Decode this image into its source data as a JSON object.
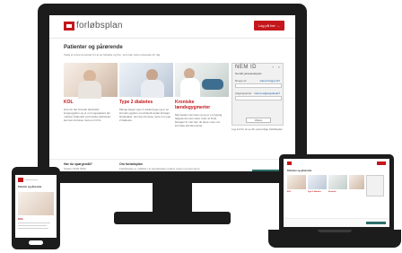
{
  "site": {
    "logo_text": "forløbsplan",
    "login_label": "Log på her →",
    "page_title": "Patienter og pårørende",
    "intro": "Vælg et emne herunder for at se forløbet og finn, som kan være relevante for dig."
  },
  "cards": [
    {
      "title": "KOL",
      "body": "Hvis du har Kronisk obstruktiv lungesygdom og er en lungepatient der mærker åndenød ved fysiske aktiviteter. Her kan du læse mere om KOL."
    },
    {
      "title": "Type 2 diabetes",
      "body": "Mange lægen type 2 sukkersyge og er en kronisk sygdom med blandt andet forhøjet blodsukker. Her kan du læse mere om type 2 diabetes."
    },
    {
      "title": "Kroniske lændegygmerter",
      "body": "Mennesker rammes og og er en hyppig følgesk der kan være svær at finde årsagen til. Her kan du læse mere om kroniske lændesmerter."
    }
  ],
  "nemid": {
    "title": "NEM ID",
    "help": "?",
    "close": "✕",
    "subtitle": "NemID jørsekudslyder",
    "user_label": "Bruger-id",
    "user_link": "Glemt bruger-id?",
    "password_label": "Adgangskode",
    "password_link": "Glemt adgangskode?",
    "next_button": "Videre",
    "footer": "Log ind for at se din personlige forløbsplan"
  },
  "footer": {
    "col1_heading": "Har du spørgsmål?",
    "col1_text": "Telefon 3333 3333",
    "col2_heading": "Om forløbsplan",
    "col2_text": "Forløbsplan er udviklet i et samarbejde mellem region og kommune"
  },
  "phone": {
    "title": "Patienter og pårørende",
    "card_title": "KOL"
  },
  "laptop": {
    "title": "Patienter og pårørende",
    "card_titles": [
      "KOL",
      "Type 2 diabetes",
      "Kroniske"
    ]
  },
  "colors": {
    "brand_red": "#c4171c",
    "device_frame": "#1c1c1c",
    "accent_teal": "#2e6f6a"
  }
}
